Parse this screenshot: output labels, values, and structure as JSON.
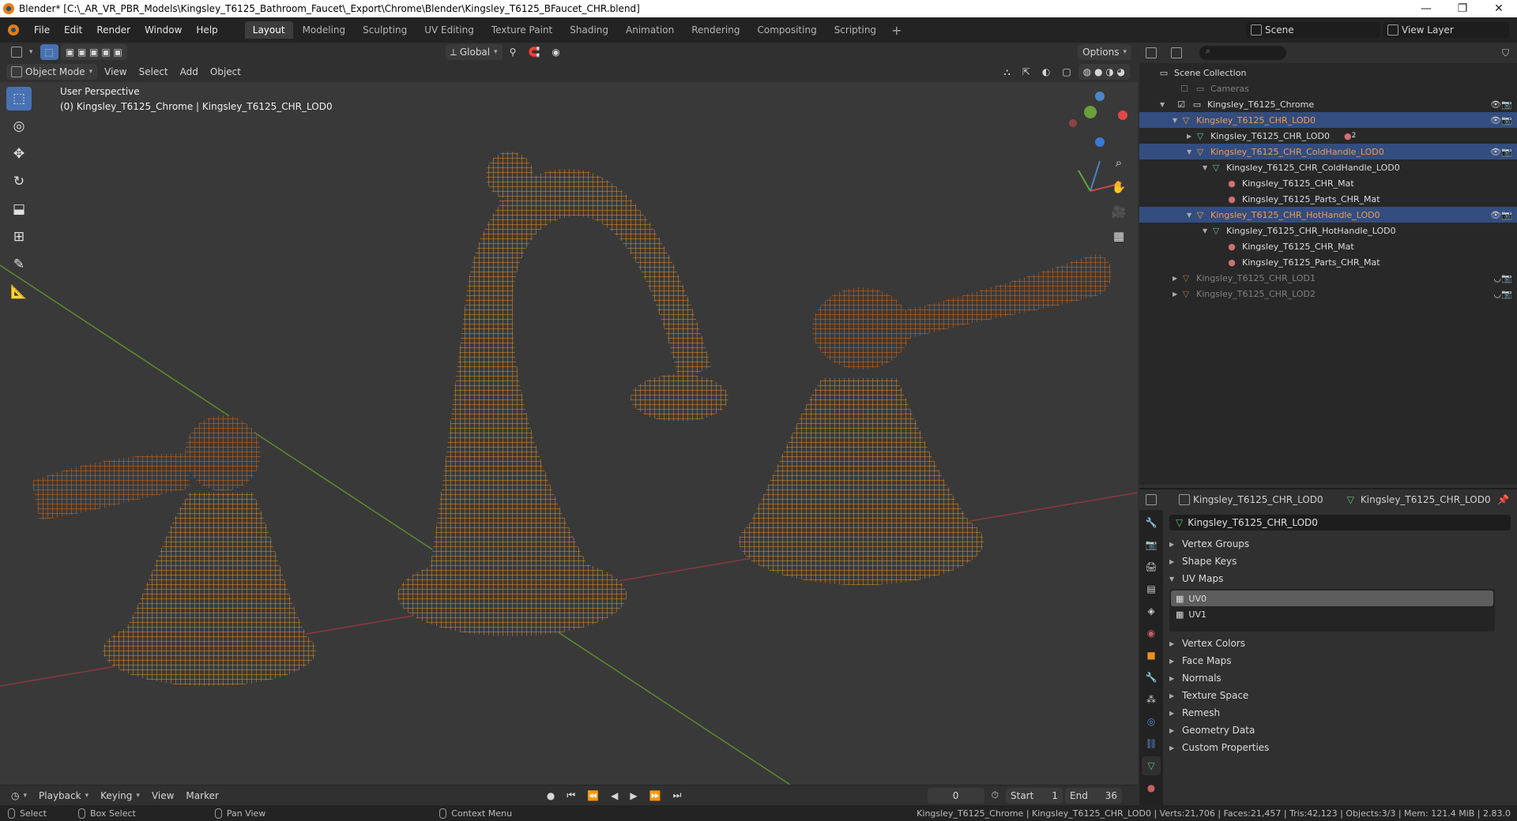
{
  "window": {
    "title": "Blender* [C:\\_AR_VR_PBR_Models\\Kingsley_T6125_Bathroom_Faucet\\_Export\\Chrome\\Blender\\Kingsley_T6125_BFaucet_CHR.blend]",
    "controls": [
      "—",
      "❐",
      "✕"
    ]
  },
  "menu": {
    "items": [
      "File",
      "Edit",
      "Render",
      "Window",
      "Help"
    ],
    "workspaces": [
      "Layout",
      "Modeling",
      "Sculpting",
      "UV Editing",
      "Texture Paint",
      "Shading",
      "Animation",
      "Rendering",
      "Compositing",
      "Scripting"
    ],
    "active_workspace": "Layout",
    "scene_label": "Scene",
    "view_layer_label": "View Layer"
  },
  "tool_header": {
    "transform_orientation": "Global",
    "options_label": "Options"
  },
  "view_header": {
    "mode": "Object Mode",
    "menus": [
      "View",
      "Select",
      "Add",
      "Object"
    ]
  },
  "viewport": {
    "perspective": "User Perspective",
    "context": "(0) Kingsley_T6125_Chrome | Kingsley_T6125_CHR_LOD0",
    "wire_color": "#e8921e",
    "selected_wire_color": "#e06a12"
  },
  "outliner": {
    "rows": [
      {
        "label": "Scene Collection",
        "style": "normal"
      },
      {
        "label": "Cameras",
        "style": "dim"
      },
      {
        "label": "Kingsley_T6125_Chrome",
        "style": "normal"
      },
      {
        "label": "Kingsley_T6125_CHR_LOD0",
        "style": "sel"
      },
      {
        "label": "Kingsley_T6125_CHR_LOD0",
        "style": "normal"
      },
      {
        "label": "Kingsley_T6125_CHR_ColdHandle_LOD0",
        "style": "sel"
      },
      {
        "label": "Kingsley_T6125_CHR_ColdHandle_LOD0",
        "style": "normal"
      },
      {
        "label": "Kingsley_T6125_CHR_Mat",
        "style": "normal"
      },
      {
        "label": "Kingsley_T6125_Parts_CHR_Mat",
        "style": "normal"
      },
      {
        "label": "Kingsley_T6125_CHR_HotHandle_LOD0",
        "style": "sel"
      },
      {
        "label": "Kingsley_T6125_CHR_HotHandle_LOD0",
        "style": "normal"
      },
      {
        "label": "Kingsley_T6125_CHR_Mat",
        "style": "normal"
      },
      {
        "label": "Kingsley_T6125_Parts_CHR_Mat",
        "style": "normal"
      },
      {
        "label": "Kingsley_T6125_CHR_LOD1",
        "style": "dim"
      },
      {
        "label": "Kingsley_T6125_CHR_LOD2",
        "style": "dim"
      }
    ],
    "badge_count": "2"
  },
  "properties": {
    "object_name": "Kingsley_T6125_CHR_LOD0",
    "mesh_name": "Kingsley_T6125_CHR_LOD0",
    "data_name": "Kingsley_T6125_CHR_LOD0",
    "panels_top": [
      "Vertex Groups",
      "Shape Keys",
      "UV Maps"
    ],
    "uv_maps": [
      "UV0",
      "UV1"
    ],
    "panels_bottom": [
      "Vertex Colors",
      "Face Maps",
      "Normals",
      "Texture Space",
      "Remesh",
      "Geometry Data",
      "Custom Properties"
    ]
  },
  "timeline": {
    "menus": [
      "Playback",
      "Keying",
      "View",
      "Marker"
    ],
    "current_frame": "0",
    "start_label": "Start",
    "start": "1",
    "end_label": "End",
    "end": "36"
  },
  "status": {
    "hints": [
      "Select",
      "Box Select",
      "Pan View",
      "Context Menu"
    ],
    "stats": "Kingsley_T6125_Chrome | Kingsley_T6125_CHR_LOD0 | Verts:21,706 | Faces:21,457 | Tris:42,123 | Objects:3/3 | Mem: 121.4 MiB | 2.83.0"
  }
}
